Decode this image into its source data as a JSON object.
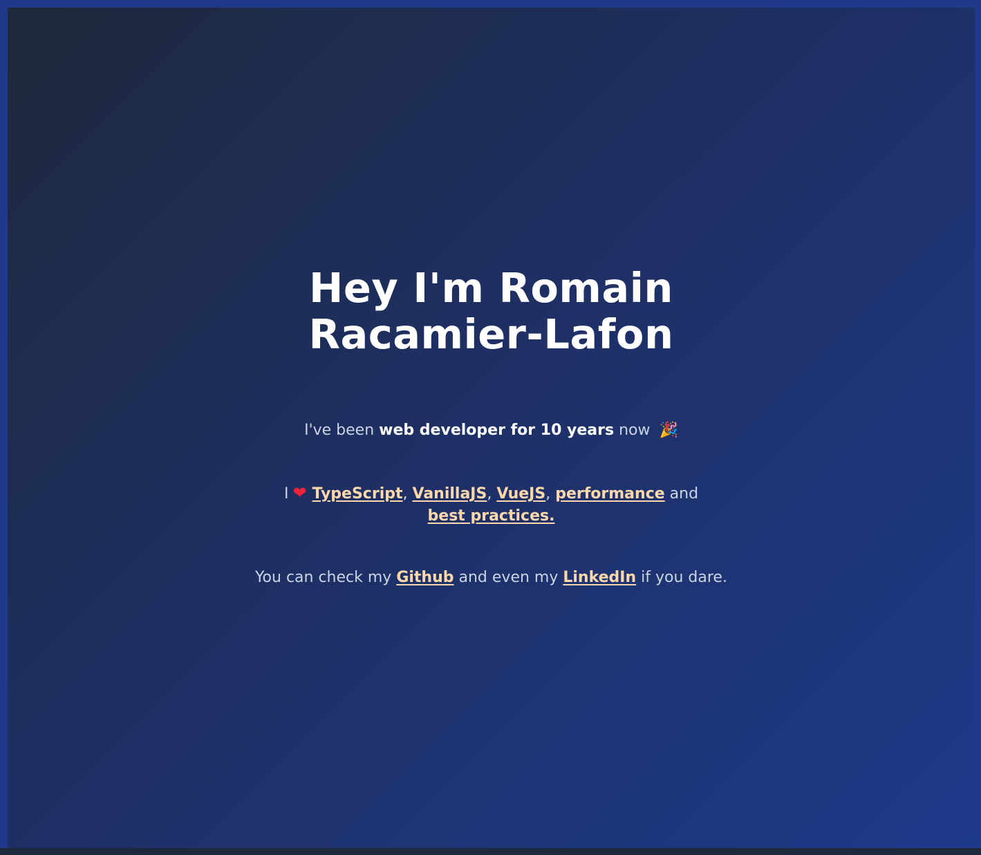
{
  "heading": {
    "line1": "Hey I'm Romain",
    "line2": "Racamier-Lafon"
  },
  "intro": {
    "prefix": "I've been",
    "emphasis": "web developer for 10 years",
    "suffix": "now",
    "emoji": "🎉"
  },
  "loves": {
    "prefix": "I",
    "heart_icon": "❤",
    "links": [
      "TypeScript",
      "VanillaJS",
      "VueJS",
      "performance",
      "best practices."
    ],
    "separator": ",",
    "and": "and"
  },
  "social": {
    "prefix": "You can check my",
    "github": "Github",
    "middle": "and even my",
    "linkedin": "LinkedIn",
    "suffix": "if you dare."
  },
  "colors": {
    "background_start": "#1e293b",
    "background_end": "#1e3a8a",
    "link": "#fed7aa",
    "text": "#cbd5e1",
    "heading": "#ffffff"
  }
}
